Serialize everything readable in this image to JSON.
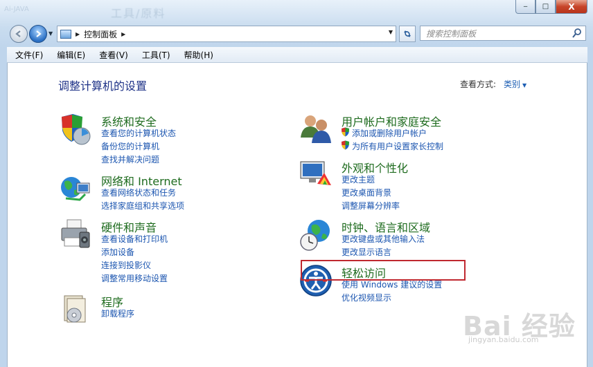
{
  "window": {
    "ghost_title": "工具/原料",
    "ghost_left": "Ai-JAVA"
  },
  "title_buttons": {
    "minimize": "‒",
    "maximize": "□",
    "close": "X"
  },
  "address_bar": {
    "path": "控制面板",
    "separator": "▶"
  },
  "search": {
    "placeholder": "搜索控制面板"
  },
  "menubar": {
    "items": [
      "文件(F)",
      "编辑(E)",
      "查看(V)",
      "工具(T)",
      "帮助(H)"
    ]
  },
  "main": {
    "title": "调整计算机的设置",
    "view_by_label": "查看方式:",
    "view_by_value": "类别"
  },
  "categories": {
    "system_security": {
      "title": "系统和安全",
      "links": [
        "查看您的计算机状态",
        "备份您的计算机",
        "查找并解决问题"
      ]
    },
    "network": {
      "title": "网络和 Internet",
      "links": [
        "查看网络状态和任务",
        "选择家庭组和共享选项"
      ]
    },
    "hardware": {
      "title": "硬件和声音",
      "links": [
        "查看设备和打印机",
        "添加设备",
        "连接到投影仪",
        "调整常用移动设置"
      ]
    },
    "programs": {
      "title": "程序",
      "links": [
        "卸载程序"
      ]
    },
    "user_accounts": {
      "title": "用户帐户和家庭安全",
      "links": [
        "添加或删除用户帐户",
        "为所有用户设置家长控制"
      ]
    },
    "appearance": {
      "title": "外观和个性化",
      "links": [
        "更改主题",
        "更改桌面背景",
        "调整屏幕分辨率"
      ]
    },
    "clock": {
      "title": "时钟、语言和区域",
      "links": [
        "更改键盘或其他输入法",
        "更改显示语言"
      ]
    },
    "ease": {
      "title": "轻松访问",
      "links": [
        "使用 Windows 建议的设置",
        "优化视频显示"
      ]
    }
  },
  "watermark": {
    "text": "Bai 经验",
    "sub": "jingyan.baidu.com"
  },
  "colors": {
    "category_title": "#1e6b1e",
    "link": "#1c56b0",
    "page_title": "#1e3287",
    "highlight": "#c0282f"
  }
}
